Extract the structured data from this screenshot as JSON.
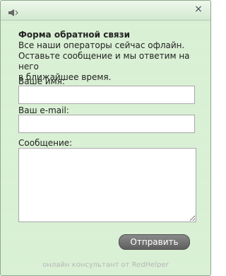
{
  "window": {
    "close_symbol": "×"
  },
  "intro": {
    "title": "Форма обратной связи",
    "line1": "Все наши операторы сейчас офлайн.",
    "line2": "Оставьте сообщение и мы ответим на него",
    "line3": "в ближайшее время."
  },
  "form": {
    "name_label": "Ваше имя:",
    "email_label": "Ваш e-mail:",
    "message_label": "Сообщение:",
    "name_value": "",
    "email_value": "",
    "message_value": ""
  },
  "actions": {
    "send_label": "Отправить"
  },
  "footer": {
    "text": "онлайн консультант от RedHelper"
  },
  "colors": {
    "panel": "#d7efd2",
    "button": "#6f6f6f"
  },
  "icons": {
    "sound": "speaker-icon",
    "close": "close-icon"
  }
}
